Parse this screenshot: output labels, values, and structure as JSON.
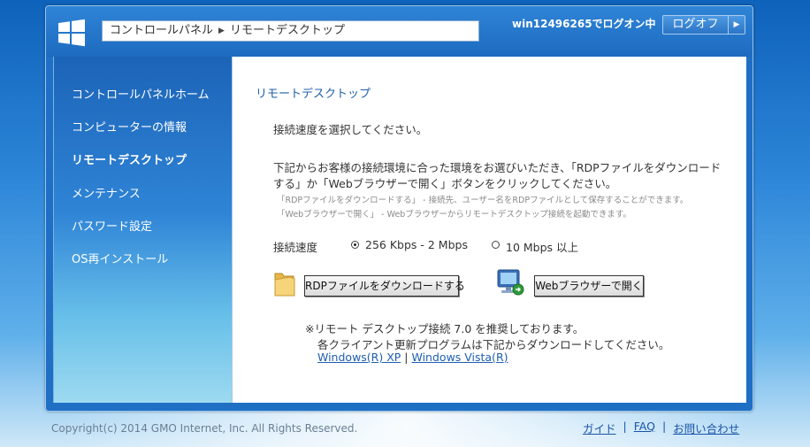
{
  "header": {
    "breadcrumb": [
      "コントロールパネル",
      "リモートデスクトップ"
    ],
    "logon_text": "win12496265でログオン中",
    "logoff_label": "ログオフ"
  },
  "sidebar": {
    "items": [
      {
        "label": "コントロールパネルホーム",
        "active": false
      },
      {
        "label": "コンピューターの情報",
        "active": false
      },
      {
        "label": "リモートデスクトップ",
        "active": true
      },
      {
        "label": "メンテナンス",
        "active": false
      },
      {
        "label": "パスワード設定",
        "active": false
      },
      {
        "label": "OS再インストール",
        "active": false
      }
    ]
  },
  "main": {
    "title": "リモートデスクトップ",
    "select_speed_text": "接続速度を選択してください。",
    "instruction_line1": "下記からお客様の接続環境に合った環境をお選びいただき、「RDPファイルをダウンロード",
    "instruction_line2": "する」か「Webブラウザーで開く」ボタンをクリックしてください。",
    "note_line1": "「RDPファイルをダウンロードする」 - 接続先、ユーザー名をRDPファイルとして保存することができます。",
    "note_line2": "「Webブラウザーで開く」 - Webブラウザーからリモートデスクトップ接続を起動できます。",
    "speed_label": "接続速度",
    "speed_options": [
      {
        "label": "256 Kbps - 2 Mbps",
        "checked": true
      },
      {
        "label": "10 Mbps 以上",
        "checked": false
      }
    ],
    "rdp_button": "RDPファイルをダウンロードする",
    "web_button": "Webブラウザーで開く",
    "recommend_line1": "※リモート デスクトップ接続 7.0 を推奨しております。",
    "recommend_line2": "各クライアント更新プログラムは下記からダウンロードしてください。",
    "link_xp": "Windows(R) XP",
    "link_sep": "|",
    "link_vista": "Windows Vista(R)"
  },
  "footer": {
    "copyright": "Copyright(c) 2014 GMO Internet, Inc. All Rights Reserved.",
    "links": [
      "ガイド",
      "FAQ",
      "お問い合わせ"
    ],
    "separator": "|"
  },
  "colors": {
    "accent": "#1f6fc4",
    "title_blue": "#1f60a8",
    "link_blue": "#1f5fb0"
  }
}
